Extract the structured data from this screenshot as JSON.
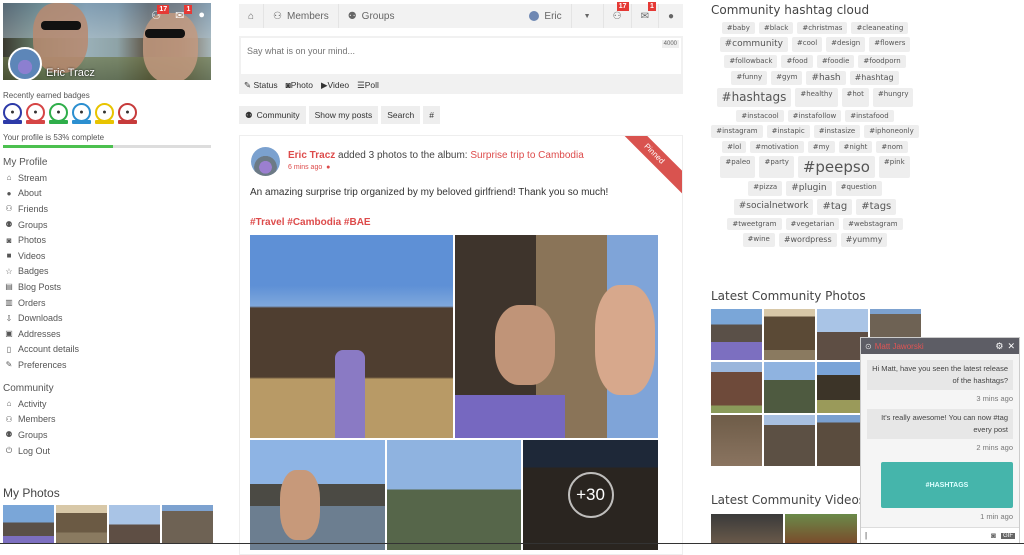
{
  "profile": {
    "name": "Eric Tracz",
    "friend_requests": "17",
    "messages": "1",
    "badges_label": "Recently earned badges",
    "badges": [
      {
        "icon": "user-icon",
        "color": "#2d3aa8"
      },
      {
        "icon": "laptop-icon",
        "color": "#d64545"
      },
      {
        "icon": "comment-icon",
        "color": "#2fae4a"
      },
      {
        "icon": "users-icon",
        "color": "#2b8fd0"
      },
      {
        "icon": "group-icon",
        "color": "#e8c400"
      },
      {
        "icon": "family-icon",
        "color": "#c73b3b"
      }
    ],
    "completion_label": "Your profile is 53% complete",
    "completion_percent": 53
  },
  "my_profile": {
    "title": "My Profile",
    "items": [
      {
        "label": "Stream",
        "icon": "home-icon",
        "glyph": "⌂"
      },
      {
        "label": "About",
        "icon": "user-icon",
        "glyph": "●"
      },
      {
        "label": "Friends",
        "icon": "friends-icon",
        "glyph": "⚇"
      },
      {
        "label": "Groups",
        "icon": "groups-icon",
        "glyph": "⚉"
      },
      {
        "label": "Photos",
        "icon": "camera-icon",
        "glyph": "◙"
      },
      {
        "label": "Videos",
        "icon": "video-icon",
        "glyph": "■"
      },
      {
        "label": "Badges",
        "icon": "star-icon",
        "glyph": "☆"
      },
      {
        "label": "Blog Posts",
        "icon": "file-icon",
        "glyph": "▤"
      },
      {
        "label": "Orders",
        "icon": "orders-icon",
        "glyph": "▥"
      },
      {
        "label": "Downloads",
        "icon": "download-icon",
        "glyph": "⇩"
      },
      {
        "label": "Addresses",
        "icon": "address-card-icon",
        "glyph": "▣"
      },
      {
        "label": "Account details",
        "icon": "clipboard-icon",
        "glyph": "▯"
      },
      {
        "label": "Preferences",
        "icon": "edit-icon",
        "glyph": "✎"
      }
    ]
  },
  "community_nav": {
    "title": "Community",
    "items": [
      {
        "label": "Activity",
        "icon": "home-icon",
        "glyph": "⌂"
      },
      {
        "label": "Members",
        "icon": "members-icon",
        "glyph": "⚇"
      },
      {
        "label": "Groups",
        "icon": "groups-icon",
        "glyph": "⚉"
      },
      {
        "label": "Log Out",
        "icon": "power-icon",
        "glyph": "⏻"
      }
    ]
  },
  "my_photos": {
    "title": "My Photos"
  },
  "topbar": {
    "members": "Members",
    "groups": "Groups",
    "user": "Eric",
    "friend_requests": "17",
    "messages": "1"
  },
  "postbox": {
    "placeholder": "Say what is on your mind...",
    "counter": "4000",
    "actions": [
      "Status",
      "Photo",
      "Video",
      "Poll"
    ]
  },
  "filters": [
    "Community",
    "Show my posts",
    "Search",
    "#"
  ],
  "post": {
    "author": "Eric Tracz",
    "action": " added 3 photos to the album: ",
    "album": "Surprise trip to Cambodia",
    "time": "6 mins ago",
    "pinned": "Pinned",
    "text": "An amazing surprise trip organized by my beloved girlfriend! Thank you so much!",
    "hashtags": "#Travel #Cambodia #BAE",
    "more_photos": "+30"
  },
  "hashtag_cloud": {
    "title": "Community hashtag cloud",
    "tags": [
      {
        "t": "#baby",
        "s": 7
      },
      {
        "t": "#black",
        "s": 7
      },
      {
        "t": "#christmas",
        "s": 7
      },
      {
        "t": "#cleaneating",
        "s": 7
      },
      {
        "t": "#community",
        "s": 9
      },
      {
        "t": "#cool",
        "s": 7
      },
      {
        "t": "#design",
        "s": 7
      },
      {
        "t": "#flowers",
        "s": 7
      },
      {
        "t": "#followback",
        "s": 7
      },
      {
        "t": "#food",
        "s": 7
      },
      {
        "t": "#foodie",
        "s": 7
      },
      {
        "t": "#foodporn",
        "s": 7
      },
      {
        "t": "#funny",
        "s": 7
      },
      {
        "t": "#gym",
        "s": 7
      },
      {
        "t": "#hash",
        "s": 9
      },
      {
        "t": "#hashtag",
        "s": 8
      },
      {
        "t": "#hashtags",
        "s": 12
      },
      {
        "t": "#healthy",
        "s": 7
      },
      {
        "t": "#hot",
        "s": 7
      },
      {
        "t": "#hungry",
        "s": 7
      },
      {
        "t": "#instacool",
        "s": 7
      },
      {
        "t": "#instafollow",
        "s": 7
      },
      {
        "t": "#instafood",
        "s": 7
      },
      {
        "t": "#instagram",
        "s": 7
      },
      {
        "t": "#instapic",
        "s": 7
      },
      {
        "t": "#instasize",
        "s": 7
      },
      {
        "t": "#iphoneonly",
        "s": 7
      },
      {
        "t": "#lol",
        "s": 7
      },
      {
        "t": "#motivation",
        "s": 7
      },
      {
        "t": "#my",
        "s": 7
      },
      {
        "t": "#night",
        "s": 7
      },
      {
        "t": "#nom",
        "s": 7
      },
      {
        "t": "#paleo",
        "s": 7
      },
      {
        "t": "#party",
        "s": 7
      },
      {
        "t": "#peepso",
        "s": 15
      },
      {
        "t": "#pink",
        "s": 7
      },
      {
        "t": "#pizza",
        "s": 7
      },
      {
        "t": "#plugin",
        "s": 9
      },
      {
        "t": "#question",
        "s": 7
      },
      {
        "t": "#socialnetwork",
        "s": 9
      },
      {
        "t": "#tag",
        "s": 10
      },
      {
        "t": "#tags",
        "s": 10
      },
      {
        "t": "#tweetgram",
        "s": 7
      },
      {
        "t": "#vegetarian",
        "s": 7
      },
      {
        "t": "#webstagram",
        "s": 7
      },
      {
        "t": "#wine",
        "s": 7
      },
      {
        "t": "#wordpress",
        "s": 8
      },
      {
        "t": "#yummy",
        "s": 8
      }
    ]
  },
  "latest_photos": {
    "title": "Latest Community Photos"
  },
  "latest_videos": {
    "title": "Latest Community Videos"
  },
  "chat": {
    "name": "Matt Jaworski",
    "messages": [
      {
        "text": "Hi Matt, have you seen the latest release of the hashtags?",
        "time": "3 mins ago"
      },
      {
        "text": "It's really awesome! You can now #tag every post",
        "time": "2 mins ago"
      }
    ],
    "card": "#HASHTAGS",
    "card_time": "1 min ago"
  }
}
